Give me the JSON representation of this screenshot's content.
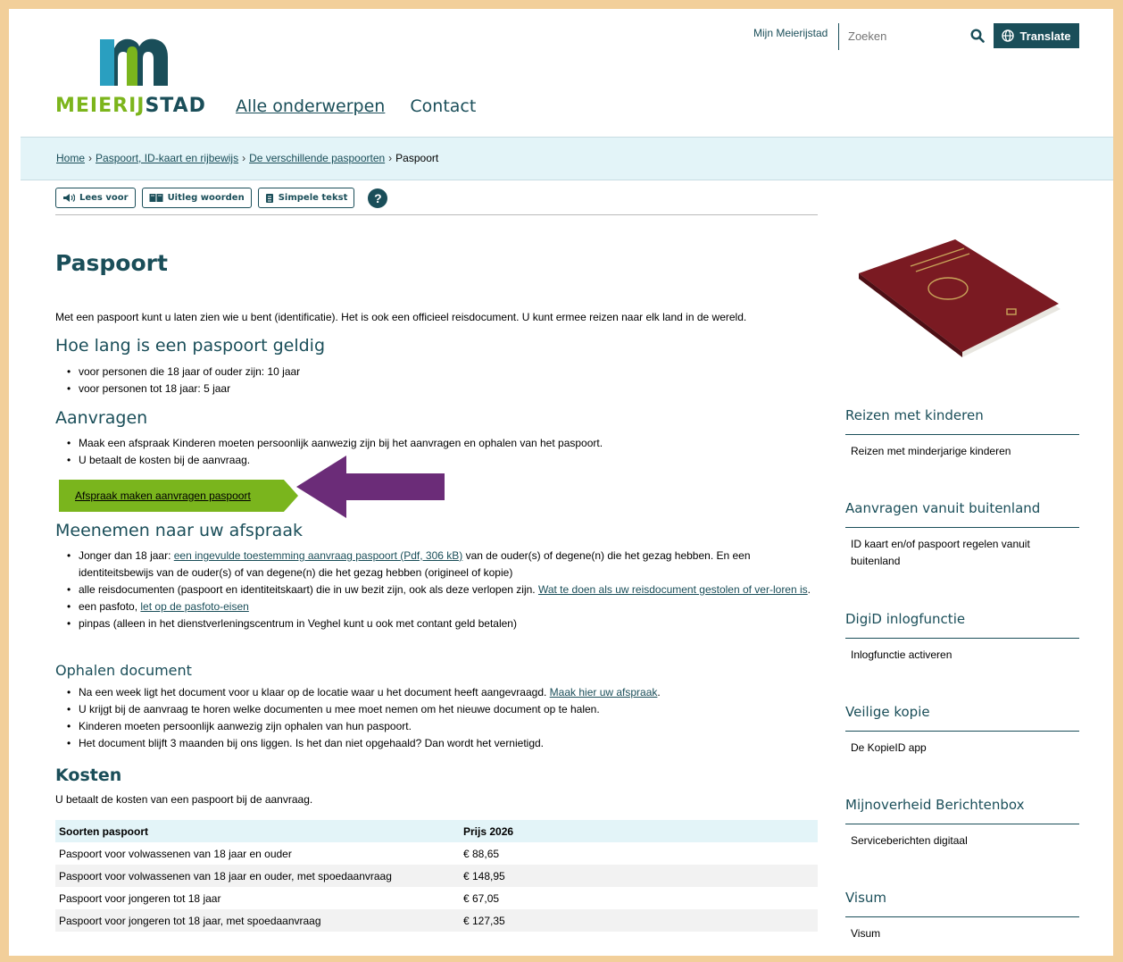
{
  "brand": {
    "logo_part1": "MEIERIJ",
    "logo_part2": "STAD",
    "green": "#7ab51d",
    "teal": "#1a4e59"
  },
  "header": {
    "nav": [
      "Alle onderwerpen",
      "Contact"
    ],
    "mijn": "Mijn Meierijstad",
    "search_placeholder": "Zoeken",
    "translate": "Translate"
  },
  "breadcrumb": {
    "home": "Home",
    "c1": "Paspoort, ID-kaart en rijbewijs",
    "c2": "De verschillende paspoorten",
    "current": "Paspoort"
  },
  "tools": {
    "lees": "Lees voor",
    "uitleg": "Uitleg woorden",
    "simpel": "Simpele tekst",
    "help": "?"
  },
  "page": {
    "title": "Paspoort",
    "intro": "Met een paspoort kunt u laten zien wie u bent (identificatie). Het is ook een officieel reisdocument. U kunt ermee reizen naar elk land in de wereld.",
    "h_geldig": "Hoe lang is een paspoort geldig",
    "geldig": [
      "voor personen die 18 jaar of ouder zijn: 10 jaar",
      "voor personen tot 18 jaar: 5 jaar"
    ],
    "h_aanvragen": "Aanvragen",
    "aanvragen": [
      "Maak een afspraak  Kinderen moeten persoonlijk aanwezig zijn bij het aanvragen en ophalen van het paspoort.",
      "U betaalt de kosten bij de aanvraag."
    ],
    "cta": "Afspraak maken aanvragen paspoort",
    "h_meenemen": "Meenemen naar uw afspraak",
    "m1_pre": "Jonger dan 18 jaar: ",
    "m1_link": "een ingevulde toestemming aanvraag paspoort (Pdf, 306 kB)",
    "m1_post": " van de ouder(s) of degene(n) die het gezag hebben.  En een identiteitsbewijs van de ouder(s) of van degene(n) die het gezag hebben (origineel of kopie)",
    "m2_pre": "alle reisdocumenten (paspoort en identiteitskaart) die in uw bezit zijn, ook als deze verlopen zijn. ",
    "m2_link": "Wat te doen als uw reisdocument gestolen of ver-loren is",
    "m2_post": ".",
    "m3_pre": "een pasfoto, ",
    "m3_link": "let op de pasfoto-eisen",
    "m4": "pinpas (alleen in het dienstverleningscentrum in Veghel kunt u ook met contant geld betalen)",
    "h_ophalen": "Ophalen document",
    "o1_pre": "Na een week ligt het document voor u klaar op de locatie waar u het document heeft aangevraagd. ",
    "o1_link": "Maak hier uw afspraak",
    "o1_post": ".",
    "o2": "U krijgt bij de aanvraag te horen welke documenten u mee moet nemen om het nieuwe document op te halen.",
    "o3": "Kinderen moeten persoonlijk aanwezig zijn ophalen van hun paspoort.",
    "o4": "Het document blijft 3 maanden bij ons liggen. Is het dan niet opgehaald? Dan wordt het vernietigd.",
    "h_kosten": "Kosten",
    "kosten_intro": "U betaalt de kosten van een paspoort bij de aanvraag.",
    "table_head": [
      "Soorten paspoort",
      "Prijs 2026"
    ],
    "table_rows": [
      [
        "Paspoort voor volwassenen van 18 jaar en ouder",
        "€ 88,65"
      ],
      [
        "Paspoort voor volwassenen van 18 jaar en ouder, met spoedaanvraag",
        "€ 148,95"
      ],
      [
        "Paspoort voor jongeren tot 18 jaar",
        "€ 67,05"
      ],
      [
        "Paspoort voor jongeren tot 18 jaar, met spoedaanvraag",
        "€ 127,35"
      ]
    ]
  },
  "sidebar": [
    {
      "heading": "Reizen met kinderen",
      "item": "Reizen met minderjarige kinderen"
    },
    {
      "heading": "Aanvragen vanuit buitenland",
      "item": "ID kaart en/of paspoort regelen vanuit buitenland"
    },
    {
      "heading": "DigiD inlogfunctie",
      "item": "Inlogfunctie activeren"
    },
    {
      "heading": "Veilige kopie",
      "item": "De KopieID app"
    },
    {
      "heading": "Mijnoverheid Berichtenbox",
      "item": "Serviceberichten digitaal"
    },
    {
      "heading": "Visum",
      "item": "Visum"
    }
  ],
  "annotation_arrow_color": "#6b2c78"
}
